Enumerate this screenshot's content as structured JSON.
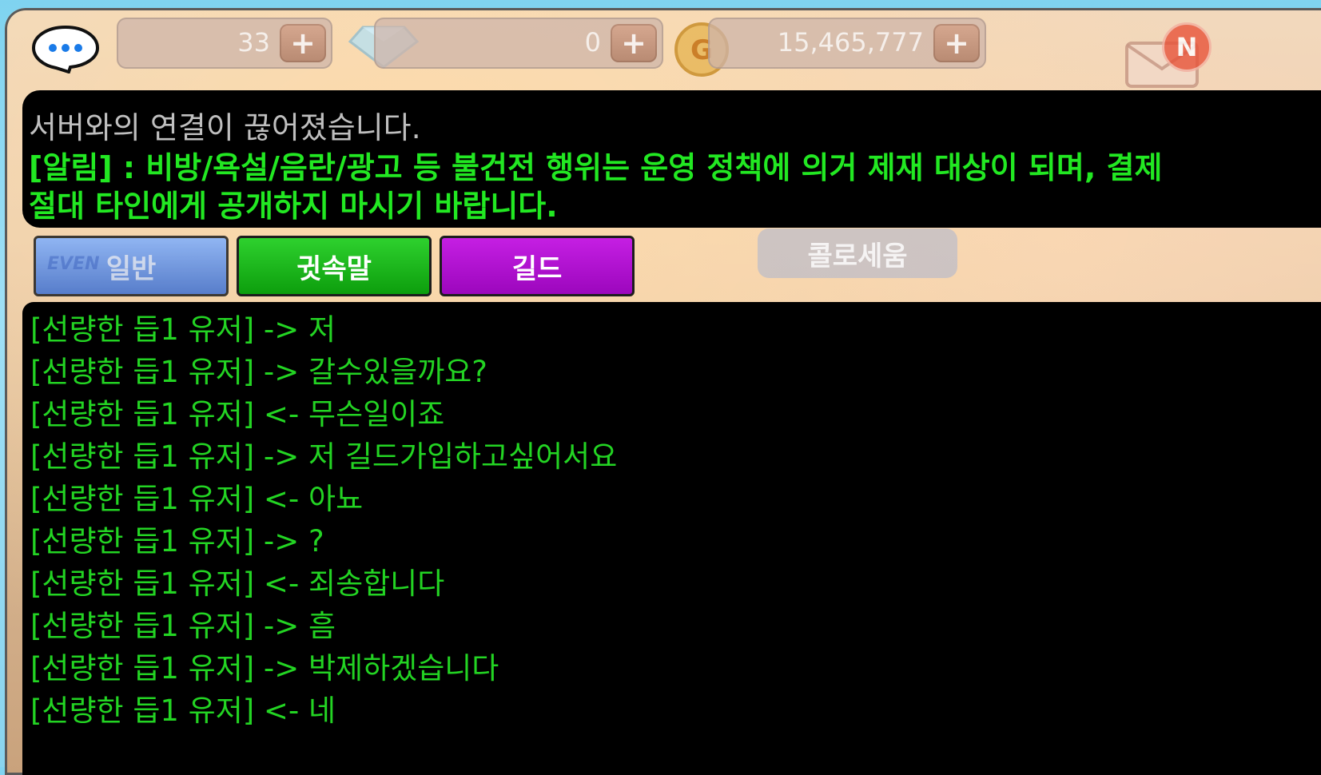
{
  "topbar": {
    "energy_value": "33",
    "gem_value": "0",
    "gold_value": "15,465,777",
    "plus_label": "+",
    "mail_badge": "N"
  },
  "notice": {
    "line1": "서버와의 연결이 끊어졌습니다.",
    "line2": "[알림] : 비방/욕설/음란/광고 등 불건전 행위는 운영 정책에 의거 제재 대상이 되며, 결제",
    "line3": "절대 타인에게 공개하지 마시기 바랍니다."
  },
  "tabs": {
    "general": "일반",
    "whisper": "귓속말",
    "guild": "길드",
    "event_overlay": "EVEN"
  },
  "background_button": "콜로세움",
  "chat": [
    "[선량한 듭1 유저] -> 저",
    "[선량한 듭1 유저] -> 갈수있을까요?",
    "[선량한 듭1 유저] <- 무슨일이죠",
    "[선량한 듭1 유저] -> 저 길드가입하고싶어서요",
    "[선량한 듭1 유저] <- 아뇨",
    "[선량한 듭1 유저] -> ?",
    "[선량한 듭1 유저] <- 죄송합니다",
    "[선량한 듭1 유저] -> 흠",
    "[선량한 듭1 유저] -> 박제하겠습니다",
    "[선량한 듭1 유저] <- 네"
  ],
  "colors": {
    "chat_green": "#23d423",
    "notice_green": "#22e822",
    "tab_whisper": "#1fb81f",
    "tab_guild": "#b012d0",
    "tab_general": "#5a8fe8"
  }
}
